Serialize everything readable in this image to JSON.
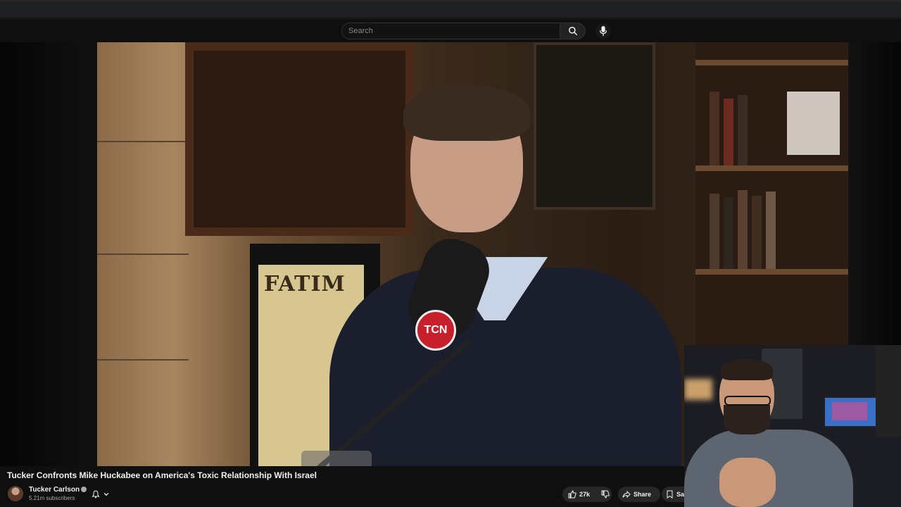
{
  "search": {
    "placeholder": "Search"
  },
  "icons": {
    "search": "search-icon",
    "mic": "mic-icon",
    "bell": "bell-icon",
    "chevron": "chevron-down-icon",
    "like": "thumbs-up-icon",
    "dislike": "thumbs-down-icon",
    "share": "share-icon",
    "save": "bookmark-icon",
    "verified": "verified-icon"
  },
  "video": {
    "title": "Tucker Confronts Mike Huckabee on America's Toxic Relationship With Israel",
    "frame_text": {
      "poster": "FATIM",
      "mic_logo": "TCN"
    }
  },
  "channel": {
    "name": "Tucker Carlson",
    "subscribers": "5.21m subscribers"
  },
  "actions": {
    "likes": "27k",
    "share_label": "Share",
    "save_label": "Save"
  },
  "colors": {
    "background": "#0f0f0f",
    "button_bg": "#272727",
    "text": "#f1f1f1",
    "muted": "#aaaaaa"
  }
}
